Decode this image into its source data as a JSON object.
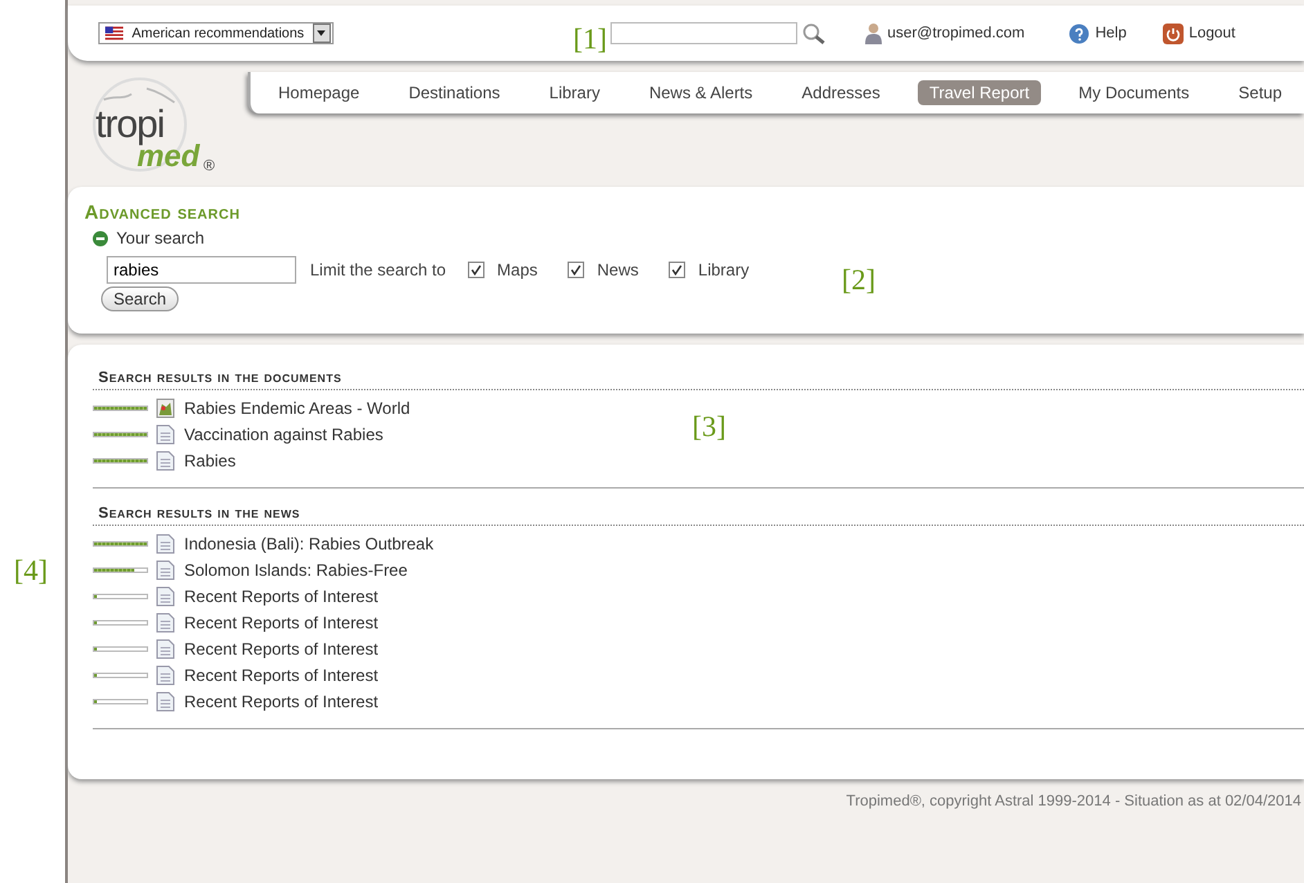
{
  "top_bar": {
    "recommendations": "American recommendations",
    "user": "user@tropimed.com",
    "links": [
      {
        "label": "Help",
        "kind": "help"
      },
      {
        "label": "Logout",
        "kind": "logout"
      }
    ]
  },
  "logo": {
    "word": "tropi",
    "accent": "med",
    "mark": "®"
  },
  "nav": [
    {
      "label": "Homepage",
      "selected": false
    },
    {
      "label": "Destinations",
      "selected": false
    },
    {
      "label": "Library",
      "selected": false
    },
    {
      "label": "News & Alerts",
      "selected": false
    },
    {
      "label": "Addresses",
      "selected": false
    },
    {
      "label": "Travel Report",
      "selected": true
    },
    {
      "label": "My Documents",
      "selected": false
    },
    {
      "label": "Setup",
      "selected": false
    }
  ],
  "advanced_search": {
    "title": "Advanced search",
    "toggle_label": "Your search",
    "query": "rabies",
    "limit_label": "Limit the search to",
    "filters": [
      {
        "label": "Maps",
        "checked": true
      },
      {
        "label": "News",
        "checked": true
      },
      {
        "label": "Library",
        "checked": true
      }
    ],
    "button": "Search"
  },
  "result_sections": [
    {
      "title": "Search results in the documents",
      "items": [
        {
          "title": "Rabies Endemic Areas - World",
          "kind": "map",
          "level": 1
        },
        {
          "title": "Vaccination against Rabies",
          "kind": "document",
          "level": 1
        },
        {
          "title": "Rabies",
          "kind": "document",
          "level": 1
        }
      ]
    },
    {
      "title": "Search results in the news",
      "items": [
        {
          "title": "Indonesia (Bali): Rabies Outbreak",
          "kind": "document",
          "level": 1
        },
        {
          "title": "Solomon Islands: Rabies-Free",
          "kind": "document",
          "level": 0.75
        },
        {
          "title": "Recent Reports of Interest",
          "kind": "document",
          "level": 0.05
        },
        {
          "title": "Recent Reports of Interest",
          "kind": "document",
          "level": 0.05
        },
        {
          "title": "Recent Reports of Interest",
          "kind": "document",
          "level": 0.05
        },
        {
          "title": "Recent Reports of Interest",
          "kind": "document",
          "level": 0.05
        },
        {
          "title": "Recent Reports of Interest",
          "kind": "document",
          "level": 0.05
        }
      ]
    }
  ],
  "footer": "Tropimed®, copyright Astral 1999-2014 - Situation as at 02/04/2014",
  "annotations": [
    {
      "label": "[1]"
    },
    {
      "label": "[2]"
    },
    {
      "label": "[3]"
    },
    {
      "label": "[4]"
    }
  ]
}
